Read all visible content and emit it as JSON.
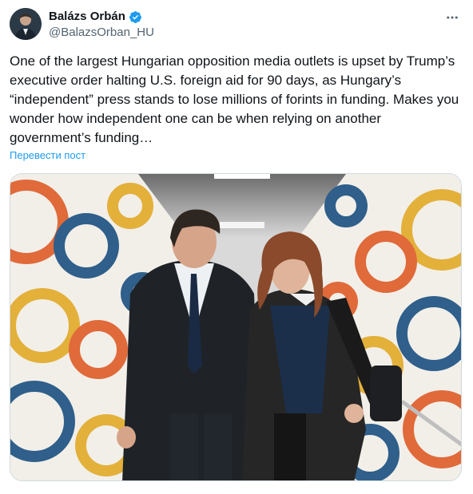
{
  "author": {
    "display_name": "Balázs Orbán",
    "handle": "@BalazsOrban_HU",
    "verified": true
  },
  "icons": {
    "verified": "verified-badge-icon",
    "more": "more-options-icon"
  },
  "colors": {
    "link": "#1d9bf0",
    "secondary_text": "#536471",
    "verified_badge": "#1d9bf0"
  },
  "tweet": {
    "text": "One of the largest Hungarian opposition media outlets is upset by Trump’s executive order halting U.S. foreign aid for 90 days, as Hungary’s “independent” press stands to lose millions of forints in funding. Makes you wonder how independent one can be when relying on another government’s funding…",
    "translate_label": "Перевести пост"
  }
}
